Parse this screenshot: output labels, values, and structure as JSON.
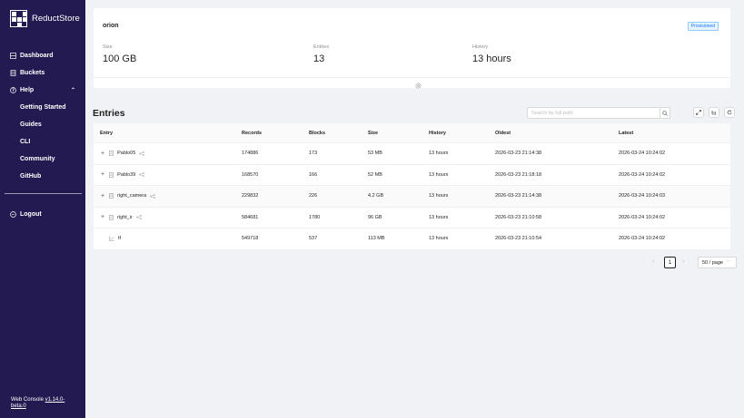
{
  "sidebar": {
    "brand": "ReductStore",
    "nav": [
      {
        "label": "Dashboard",
        "icon": "dashboard-icon"
      },
      {
        "label": "Buckets",
        "icon": "buckets-icon"
      },
      {
        "label": "Help",
        "icon": "help-icon"
      }
    ],
    "help_items": [
      "Getting Started",
      "Guides",
      "CLI",
      "Community",
      "GitHub"
    ],
    "logout": "Logout",
    "version_prefix": "Web Console ",
    "version_link": "v1.14.0-",
    "version_suffix": "beta.0"
  },
  "bucket": {
    "name": "orion",
    "badge": "Provisioned",
    "stats": [
      {
        "label": "Size",
        "value": "100 GB"
      },
      {
        "label": "Entries",
        "value": "13"
      },
      {
        "label": "History",
        "value": "13 hours"
      }
    ]
  },
  "entries": {
    "title": "Entries",
    "search_placeholder": "Search by full path",
    "columns": [
      "Entry",
      "Records",
      "Blocks",
      "Size",
      "History",
      "Oldest",
      "Latest"
    ],
    "rows": [
      {
        "expandable": true,
        "name": "Pablo05",
        "records": "174886",
        "blocks": "173",
        "size": "53 MB",
        "history": "13 hours",
        "oldest": "2026-03-23 21:14:38",
        "latest": "2026-03-24 10:24:02"
      },
      {
        "expandable": true,
        "name": "Pablo39",
        "records": "168570",
        "blocks": "166",
        "size": "52 MB",
        "history": "13 hours",
        "oldest": "2026-03-23 21:18:18",
        "latest": "2026-03-24 10:24:02"
      },
      {
        "expandable": true,
        "name": "right_camera",
        "records": "229832",
        "blocks": "226",
        "size": "4.2 GB",
        "history": "13 hours",
        "oldest": "2026-03-23 21:14:38",
        "latest": "2026-03-24 10:24:03"
      },
      {
        "expandable": true,
        "name": "right_ir",
        "records": "584681",
        "blocks": "1780",
        "size": "96 GB",
        "history": "13 hours",
        "oldest": "2026-03-23 21:10:58",
        "latest": "2026-03-24 10:24:02"
      },
      {
        "expandable": false,
        "name": "tf",
        "records": "549718",
        "blocks": "537",
        "size": "113 MB",
        "history": "13 hours",
        "oldest": "2026-03-23 21:10:54",
        "latest": "2026-03-24 10:24:02"
      }
    ]
  },
  "pagination": {
    "current": "1",
    "page_size": "50 / page"
  }
}
